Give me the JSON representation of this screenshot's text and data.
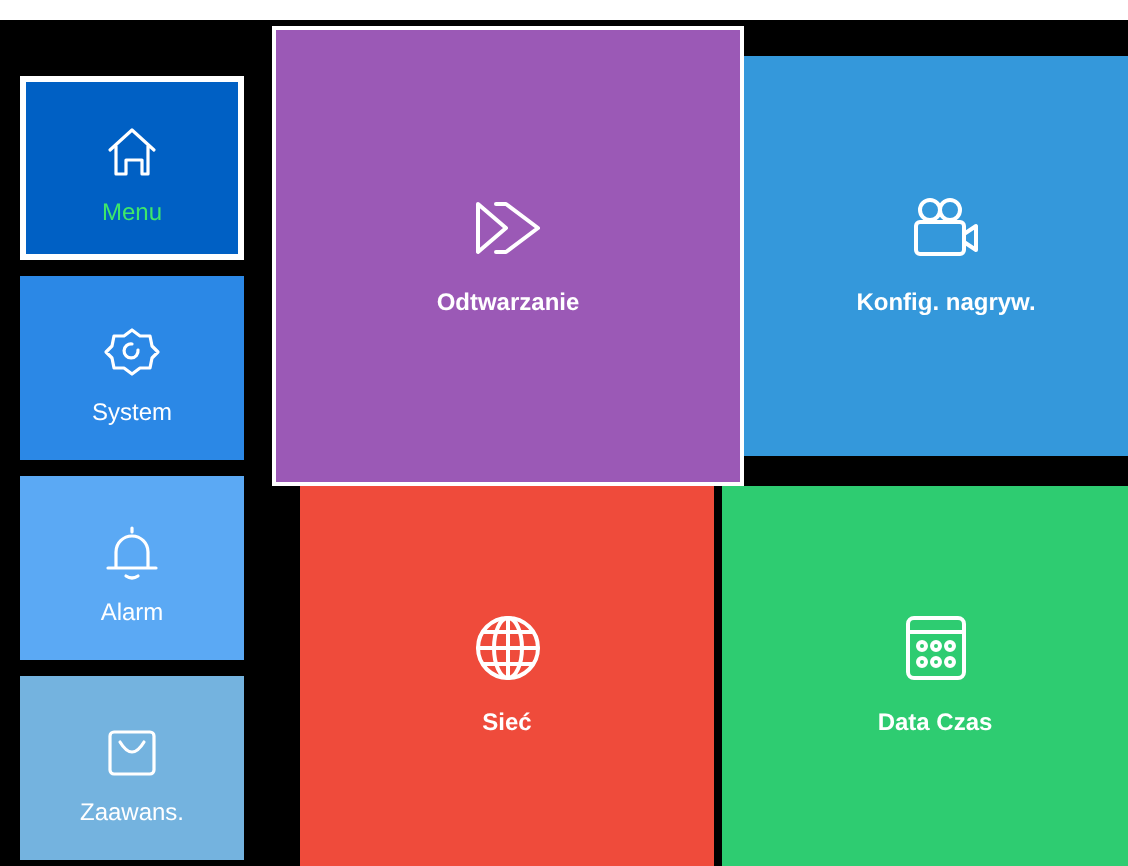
{
  "sidebar": {
    "items": [
      {
        "label": "Menu",
        "selected": true,
        "color": "#0060c4"
      },
      {
        "label": "System",
        "selected": false,
        "color": "#2b88e6"
      },
      {
        "label": "Alarm",
        "selected": false,
        "color": "#5ba9f4"
      },
      {
        "label": "Zaawans.",
        "selected": false,
        "color": "#74b3df"
      }
    ]
  },
  "tiles": [
    {
      "label": "Odtwarzanie",
      "selected": true,
      "color": "#9b59b6"
    },
    {
      "label": "Konfig. nagryw.",
      "selected": false,
      "color": "#3498db"
    },
    {
      "label": "Sieć",
      "selected": false,
      "color": "#ef4b3b"
    },
    {
      "label": "Data Czas",
      "selected": false,
      "color": "#2ecc71"
    }
  ]
}
